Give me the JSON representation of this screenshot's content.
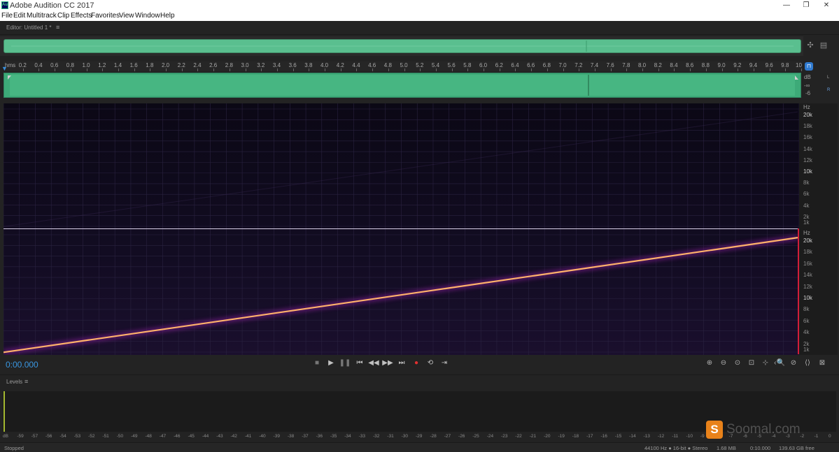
{
  "window": {
    "title": "Adobe Audition CC 2017",
    "app_icon_text": "Au",
    "controls": [
      "—",
      "❐",
      "✕"
    ]
  },
  "menu": [
    "File",
    "Edit",
    "Multitrack",
    "Clip",
    "Effects",
    "Favorites",
    "View",
    "Window",
    "Help"
  ],
  "editor": {
    "panel_title": "Editor: Untitled 1 *",
    "menu_icon": "hamburger-icon",
    "time_ruler": {
      "unit": "hms",
      "labels": [
        "0.2",
        "0.4",
        "0.6",
        "0.8",
        "1.0",
        "1.2",
        "1.4",
        "1.6",
        "1.8",
        "2.0",
        "2.2",
        "2.4",
        "2.6",
        "2.8",
        "3.0",
        "3.2",
        "3.4",
        "3.6",
        "3.8",
        "4.0",
        "4.2",
        "4.4",
        "4.6",
        "4.8",
        "5.0",
        "5.2",
        "5.4",
        "5.6",
        "5.8",
        "6.0",
        "6.2",
        "6.4",
        "6.6",
        "6.8",
        "7.0",
        "7.2",
        "7.4",
        "7.6",
        "7.8",
        "8.0",
        "8.2",
        "8.4",
        "8.6",
        "8.8",
        "9.0",
        "9.2",
        "9.4",
        "9.6",
        "9.8",
        "10"
      ]
    },
    "amplitude_scale": {
      "unit": "dB",
      "labels": [
        "-∞",
        "-6"
      ],
      "channels": [
        "L",
        "R"
      ]
    },
    "frequency_scale": {
      "unit": "Hz",
      "labels": [
        "20k",
        "18k",
        "16k",
        "14k",
        "12k",
        "10k",
        "8k",
        "6k",
        "4k",
        "2k",
        "1k"
      ]
    },
    "spectral": {
      "sweep_start_hz": 200,
      "sweep_end_hz": 20000,
      "duration_s": 10,
      "line_color": "#ffb36a"
    },
    "waveform_color": "#4dbb87",
    "timecode": "0:00.000"
  },
  "transport": [
    "stop",
    "play",
    "pause",
    "go-to-start",
    "rewind",
    "fast-forward",
    "go-to-end",
    "record",
    "loop",
    "skip-selection"
  ],
  "zoom": [
    "zoom-in-amplitude",
    "zoom-out-amplitude",
    "zoom-reset",
    "zoom-in-full",
    "zoom-selection",
    "zoom-in",
    "zoom-out",
    "zoom-in-time",
    "zoom-out-time"
  ],
  "levels": {
    "panel_title": "Levels",
    "meter_level_fraction": 0.0,
    "scale": [
      "dB",
      "-59",
      "-57",
      "-56",
      "-54",
      "-53",
      "-52",
      "-51",
      "-50",
      "-49",
      "-48",
      "-47",
      "-46",
      "-45",
      "-44",
      "-43",
      "-42",
      "-41",
      "-40",
      "-39",
      "-38",
      "-37",
      "-36",
      "-35",
      "-34",
      "-33",
      "-32",
      "-31",
      "-30",
      "-29",
      "-28",
      "-27",
      "-26",
      "-25",
      "-24",
      "-23",
      "-22",
      "-21",
      "-20",
      "-19",
      "-18",
      "-17",
      "-16",
      "-15",
      "-14",
      "-13",
      "-12",
      "-11",
      "-10",
      "-9",
      "-8",
      "-7",
      "-6",
      "-5",
      "-4",
      "-3",
      "-2",
      "-1",
      "0"
    ]
  },
  "status": {
    "state": "Stopped",
    "format": "44100 Hz ● 16-bit ● Stereo",
    "size": "1.68 MB",
    "duration": "0:10.000",
    "free": "139.63 GB free"
  },
  "watermark": {
    "logo": "S",
    "text": "Soomal.com"
  }
}
